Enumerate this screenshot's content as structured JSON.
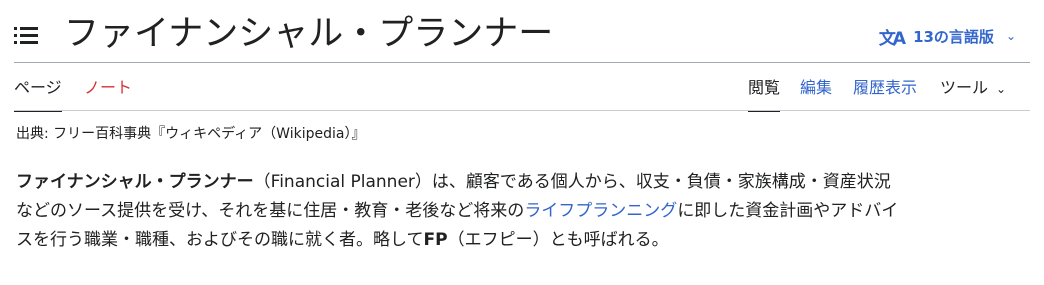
{
  "header": {
    "title": "ファイナンシャル・プランナー",
    "languages_label": "13の言語版"
  },
  "tabs": {
    "page": "ページ",
    "talk": "ノート",
    "read": "閲覧",
    "edit": "編集",
    "history": "履歴表示",
    "tools": "ツール"
  },
  "site_sub": "出典: フリー百科事典『ウィキペディア（Wikipedia）』",
  "article": {
    "term": "ファイナンシャル・プランナー",
    "line1_rest": "（Financial Planner）は、顧客である個人から、収支・負債・家族構成・資産状況",
    "line2_pre": "などのソース提供を受け、それを基に住居・教育・老後など将来の",
    "link": "ライフプランニング",
    "line2_post": "に即した資金計画やアドバイ",
    "line3_pre": "スを行う職業・職種、およびその職に就く者。略して",
    "abbr": "FP",
    "line3_post": "（エフピー）とも呼ばれる。"
  },
  "colors": {
    "link": "#3366cc",
    "redlink": "#d73333",
    "text": "#202122",
    "rule": "#a2a9b1"
  }
}
